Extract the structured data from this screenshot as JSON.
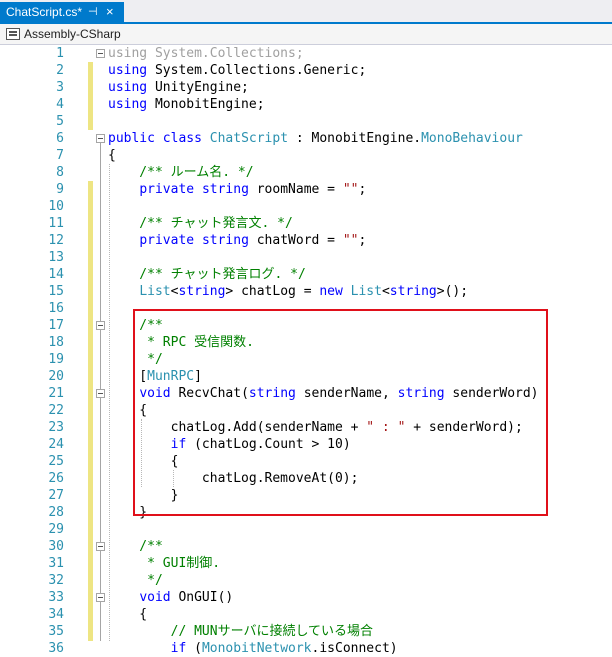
{
  "tab": {
    "title": "ChatScript.cs*",
    "pin_icon": "pin-icon",
    "close_icon": "close-icon"
  },
  "navbar": {
    "project": "Assembly-CSharp",
    "icon": "csharp-project-icon"
  },
  "colors": {
    "keyword": "#0000ff",
    "type": "#2b91af",
    "comment": "#008000",
    "string": "#a31515",
    "highlight_border": "#e0101a",
    "tab_active": "#007acc"
  },
  "lines": [
    {
      "n": "1",
      "parts": [
        {
          "t": "using System.Collections;",
          "c": "gr"
        }
      ]
    },
    {
      "n": "2",
      "parts": [
        {
          "t": "using",
          "c": "kw"
        },
        {
          "t": " System.Collections.Generic;",
          "c": ""
        }
      ]
    },
    {
      "n": "3",
      "parts": [
        {
          "t": "using",
          "c": "kw"
        },
        {
          "t": " UnityEngine;",
          "c": ""
        }
      ]
    },
    {
      "n": "4",
      "parts": [
        {
          "t": "using",
          "c": "kw"
        },
        {
          "t": " MonobitEngine;",
          "c": ""
        }
      ]
    },
    {
      "n": "5",
      "parts": []
    },
    {
      "n": "6",
      "parts": [
        {
          "t": "public",
          "c": "kw"
        },
        {
          "t": " ",
          "c": ""
        },
        {
          "t": "class",
          "c": "kw"
        },
        {
          "t": " ",
          "c": ""
        },
        {
          "t": "ChatScript",
          "c": "ty"
        },
        {
          "t": " : MonobitEngine.",
          "c": ""
        },
        {
          "t": "MonoBehaviour",
          "c": "ty"
        }
      ]
    },
    {
      "n": "7",
      "parts": [
        {
          "t": "{",
          "c": ""
        }
      ]
    },
    {
      "n": "8",
      "parts": [
        {
          "t": "    /** ルーム名. */",
          "c": "cm"
        }
      ]
    },
    {
      "n": "9",
      "parts": [
        {
          "t": "    ",
          "c": ""
        },
        {
          "t": "private",
          "c": "kw"
        },
        {
          "t": " ",
          "c": ""
        },
        {
          "t": "string",
          "c": "kw"
        },
        {
          "t": " roomName = ",
          "c": ""
        },
        {
          "t": "\"\"",
          "c": "st"
        },
        {
          "t": ";",
          "c": ""
        }
      ]
    },
    {
      "n": "10",
      "parts": []
    },
    {
      "n": "11",
      "parts": [
        {
          "t": "    /** チャット発言文. */",
          "c": "cm"
        }
      ]
    },
    {
      "n": "12",
      "parts": [
        {
          "t": "    ",
          "c": ""
        },
        {
          "t": "private",
          "c": "kw"
        },
        {
          "t": " ",
          "c": ""
        },
        {
          "t": "string",
          "c": "kw"
        },
        {
          "t": " chatWord = ",
          "c": ""
        },
        {
          "t": "\"\"",
          "c": "st"
        },
        {
          "t": ";",
          "c": ""
        }
      ]
    },
    {
      "n": "13",
      "parts": []
    },
    {
      "n": "14",
      "parts": [
        {
          "t": "    /** チャット発言ログ. */",
          "c": "cm"
        }
      ]
    },
    {
      "n": "15",
      "parts": [
        {
          "t": "    ",
          "c": ""
        },
        {
          "t": "List",
          "c": "ty"
        },
        {
          "t": "<",
          "c": ""
        },
        {
          "t": "string",
          "c": "kw"
        },
        {
          "t": "> chatLog = ",
          "c": ""
        },
        {
          "t": "new",
          "c": "kw"
        },
        {
          "t": " ",
          "c": ""
        },
        {
          "t": "List",
          "c": "ty"
        },
        {
          "t": "<",
          "c": ""
        },
        {
          "t": "string",
          "c": "kw"
        },
        {
          "t": ">();",
          "c": ""
        }
      ]
    },
    {
      "n": "16",
      "parts": []
    },
    {
      "n": "17",
      "parts": [
        {
          "t": "    /**",
          "c": "cm"
        }
      ]
    },
    {
      "n": "18",
      "parts": [
        {
          "t": "     * RPC 受信関数.",
          "c": "cm"
        }
      ]
    },
    {
      "n": "19",
      "parts": [
        {
          "t": "     */",
          "c": "cm"
        }
      ]
    },
    {
      "n": "20",
      "parts": [
        {
          "t": "    [",
          "c": ""
        },
        {
          "t": "MunRPC",
          "c": "ty"
        },
        {
          "t": "]",
          "c": ""
        }
      ]
    },
    {
      "n": "21",
      "parts": [
        {
          "t": "    ",
          "c": ""
        },
        {
          "t": "void",
          "c": "kw"
        },
        {
          "t": " RecvChat(",
          "c": ""
        },
        {
          "t": "string",
          "c": "kw"
        },
        {
          "t": " senderName, ",
          "c": ""
        },
        {
          "t": "string",
          "c": "kw"
        },
        {
          "t": " senderWord)",
          "c": ""
        }
      ]
    },
    {
      "n": "22",
      "parts": [
        {
          "t": "    {",
          "c": ""
        }
      ]
    },
    {
      "n": "23",
      "parts": [
        {
          "t": "        chatLog.Add(senderName + ",
          "c": ""
        },
        {
          "t": "\" : \"",
          "c": "st"
        },
        {
          "t": " + senderWord);",
          "c": ""
        }
      ]
    },
    {
      "n": "24",
      "parts": [
        {
          "t": "        ",
          "c": ""
        },
        {
          "t": "if",
          "c": "kw"
        },
        {
          "t": " (chatLog.Count > 10)",
          "c": ""
        }
      ]
    },
    {
      "n": "25",
      "parts": [
        {
          "t": "        {",
          "c": ""
        }
      ]
    },
    {
      "n": "26",
      "parts": [
        {
          "t": "            chatLog.RemoveAt(0);",
          "c": ""
        }
      ]
    },
    {
      "n": "27",
      "parts": [
        {
          "t": "        }",
          "c": ""
        }
      ]
    },
    {
      "n": "28",
      "parts": [
        {
          "t": "    }",
          "c": ""
        }
      ]
    },
    {
      "n": "29",
      "parts": []
    },
    {
      "n": "30",
      "parts": [
        {
          "t": "    /**",
          "c": "cm"
        }
      ]
    },
    {
      "n": "31",
      "parts": [
        {
          "t": "     * GUI制御.",
          "c": "cm"
        }
      ]
    },
    {
      "n": "32",
      "parts": [
        {
          "t": "     */",
          "c": "cm"
        }
      ]
    },
    {
      "n": "33",
      "parts": [
        {
          "t": "    ",
          "c": ""
        },
        {
          "t": "void",
          "c": "kw"
        },
        {
          "t": " OnGUI()",
          "c": ""
        }
      ]
    },
    {
      "n": "34",
      "parts": [
        {
          "t": "    {",
          "c": ""
        }
      ]
    },
    {
      "n": "35",
      "parts": [
        {
          "t": "        // MUNサーバに接続している場合",
          "c": "cm"
        }
      ]
    },
    {
      "n": "36",
      "parts": [
        {
          "t": "        ",
          "c": ""
        },
        {
          "t": "if",
          "c": "kw"
        },
        {
          "t": " (",
          "c": ""
        },
        {
          "t": "MonobitNetwork",
          "c": "ty"
        },
        {
          "t": ".isConnect)",
          "c": ""
        }
      ]
    }
  ]
}
